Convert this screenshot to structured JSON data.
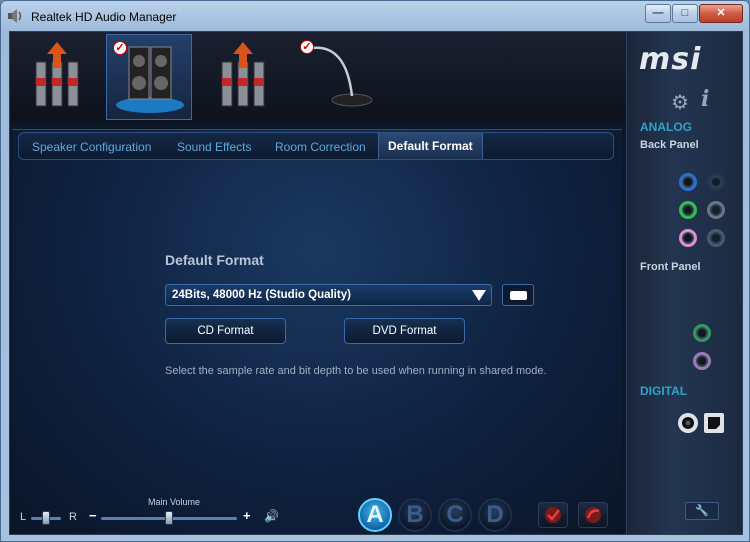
{
  "window": {
    "title": "Realtek HD Audio Manager",
    "minimize_glyph": "—",
    "maximize_glyph": "□",
    "close_glyph": "✕"
  },
  "devices": [
    {
      "name": "rear-output-connectors",
      "checked": false,
      "selected": false
    },
    {
      "name": "speakers",
      "checked": true,
      "selected": true
    },
    {
      "name": "front-output-connectors",
      "checked": false,
      "selected": false
    },
    {
      "name": "microphone",
      "checked": true,
      "selected": false
    }
  ],
  "tabs": [
    {
      "label": "Speaker Configuration",
      "active": false
    },
    {
      "label": "Sound Effects",
      "active": false
    },
    {
      "label": "Room Correction",
      "active": false
    },
    {
      "label": "Default Format",
      "active": true
    }
  ],
  "default_format": {
    "heading": "Default Format",
    "selected_format": "24Bits, 48000 Hz (Studio Quality)",
    "cd_button": "CD Format",
    "dvd_button": "DVD Format",
    "hint": "Select the sample rate and bit depth to be used when running in shared mode."
  },
  "volume": {
    "main_label": "Main Volume",
    "balance_left": "L",
    "balance_right": "R",
    "minus": "−",
    "plus": "+",
    "speaker_glyph": "🔊",
    "balance_position": 0.5,
    "main_position": 0.5
  },
  "profiles": [
    {
      "label": "A",
      "active": true
    },
    {
      "label": "B",
      "active": false
    },
    {
      "label": "C",
      "active": false
    },
    {
      "label": "D",
      "active": false
    }
  ],
  "sidebar": {
    "brand": "msi",
    "analog_heading": "ANALOG",
    "back_panel": "Back Panel",
    "front_panel": "Front Panel",
    "digital_heading": "DIGITAL",
    "back_jacks": [
      {
        "color": "#2f6fd0",
        "active": true
      },
      {
        "color": "#2a3a52",
        "active": false
      },
      {
        "color": "#2fc04a",
        "active": true
      },
      {
        "color": "#8a93a0",
        "active": false
      },
      {
        "color": "#e090d0",
        "active": true
      },
      {
        "color": "#5a6a80",
        "active": false
      }
    ],
    "front_jacks": [
      {
        "color": "#2f9a5a",
        "active": false
      },
      {
        "color": "#9a7ab8",
        "active": false
      }
    ],
    "settings_icon": "gear-icon",
    "info_icon": "info-icon",
    "wrench_glyph": "🔧"
  }
}
